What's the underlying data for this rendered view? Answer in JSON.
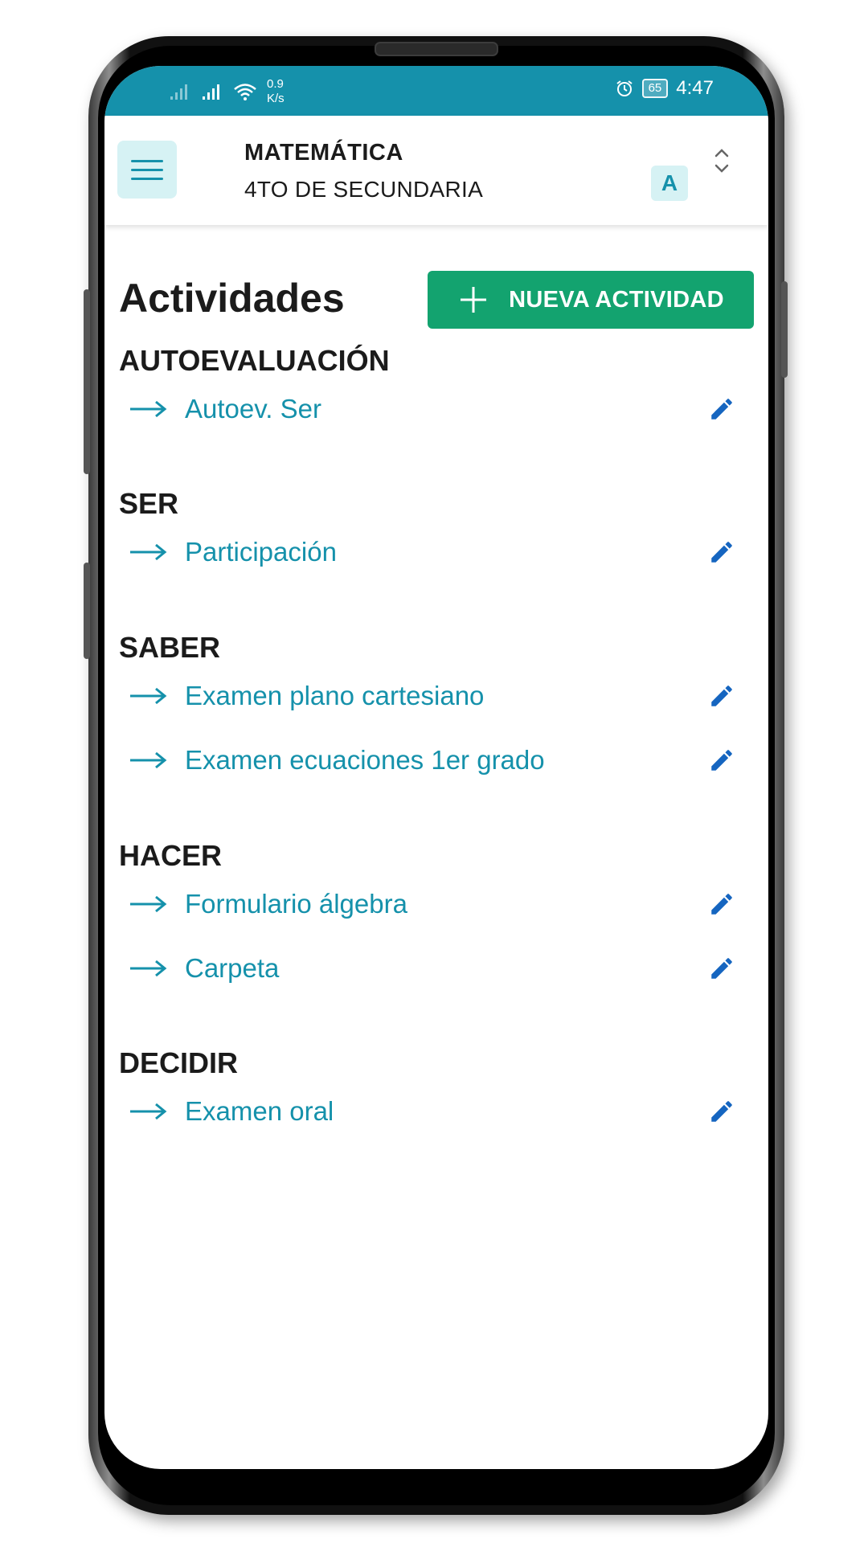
{
  "status_bar": {
    "net_speed_value": "0.9",
    "net_speed_unit": "K/s",
    "battery": "65",
    "time": "4:47"
  },
  "app_bar": {
    "course_title": "MATEMÁTICA",
    "course_subtitle": "4TO DE SECUNDARIA",
    "section_badge": "A"
  },
  "page": {
    "title": "Actividades",
    "new_button_label": "NUEVA ACTIVIDAD"
  },
  "categories": [
    {
      "name": "AUTOEVALUACIÓN",
      "items": [
        "Autoev. Ser"
      ]
    },
    {
      "name": "SER",
      "items": [
        "Participación"
      ]
    },
    {
      "name": "SABER",
      "items": [
        "Examen plano cartesiano",
        "Examen ecuaciones 1er grado"
      ]
    },
    {
      "name": "HACER",
      "items": [
        "Formulario álgebra",
        "Carpeta"
      ]
    },
    {
      "name": "DECIDIR",
      "items": [
        "Examen oral"
      ]
    }
  ],
  "colors": {
    "accent_teal": "#1591ab",
    "button_green": "#13a36f",
    "edit_blue": "#1565c0",
    "badge_bg": "#d6f2f4"
  }
}
